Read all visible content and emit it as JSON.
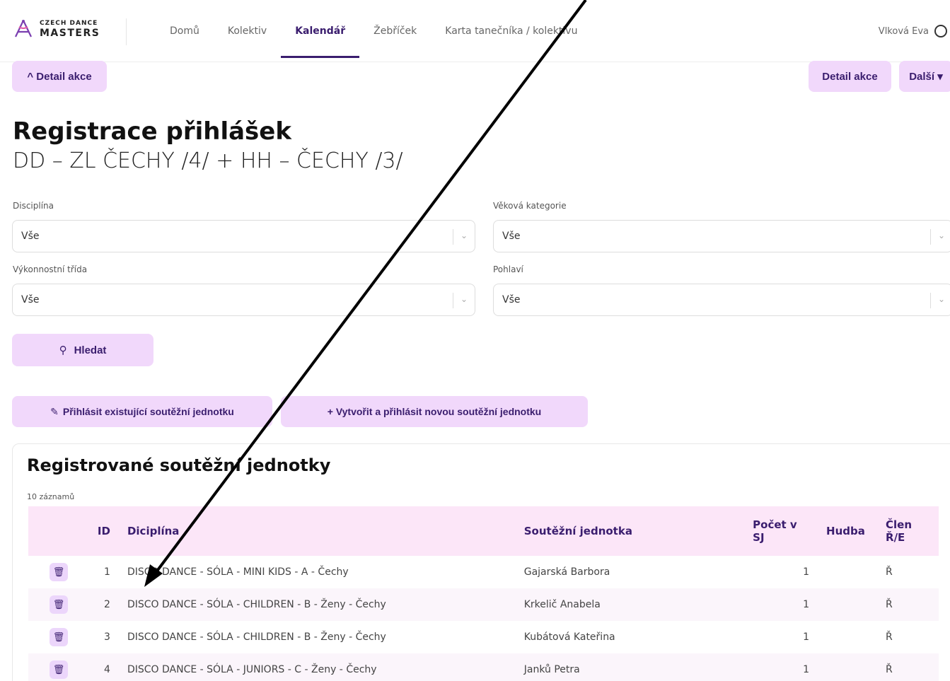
{
  "logo": {
    "line1": "CZECH DANCE",
    "line2": "MASTERS"
  },
  "nav": [
    {
      "label": "Domů",
      "active": false
    },
    {
      "label": "Kolektiv",
      "active": false
    },
    {
      "label": "Kalendář",
      "active": true
    },
    {
      "label": "Žebříček",
      "active": false
    },
    {
      "label": "Karta tanečníka / kolektivu",
      "active": false
    }
  ],
  "user": {
    "name": "Vlková Eva"
  },
  "actions": {
    "detail_left": "^ Detail akce",
    "detail_right": "Detail akce",
    "more": "Další ▾"
  },
  "page": {
    "title": "Registrace přihlášek",
    "subtitle": "DD – ZL ČECHY /4/ + HH – ČECHY /3/"
  },
  "filters": {
    "discipline": {
      "label": "Disciplína",
      "value": "Vše"
    },
    "age_category": {
      "label": "Věková kategorie",
      "value": "Vše"
    },
    "performance_class": {
      "label": "Výkonnostní třída",
      "value": "Vše"
    },
    "gender": {
      "label": "Pohlaví",
      "value": "Vše"
    },
    "search_label": "Hledat"
  },
  "buttons": {
    "register_existing": "Přihlásit existující soutěžní jednotku",
    "create_new": "+ Vytvořit a přihlásit novou soutěžní jednotku"
  },
  "panel": {
    "title": "Registrované soutěžní jednotky",
    "records": "10 záznamů",
    "columns": [
      "",
      "ID",
      "Diciplína",
      "Soutěžní jednotka",
      "Počet v SJ",
      "Hudba",
      "Člen Ř/E"
    ],
    "rows": [
      {
        "id": "1",
        "discipline": "DISCO DANCE - SÓLA - MINI KIDS - A - Čechy",
        "unit": "Gajarská Barbora",
        "count": "1",
        "music": "",
        "member": "Ř"
      },
      {
        "id": "2",
        "discipline": "DISCO DANCE - SÓLA - CHILDREN - B - Ženy - Čechy",
        "unit": "Krkelič Anabela",
        "count": "1",
        "music": "",
        "member": "Ř"
      },
      {
        "id": "3",
        "discipline": "DISCO DANCE - SÓLA - CHILDREN - B - Ženy - Čechy",
        "unit": "Kubátová Kateřina",
        "count": "1",
        "music": "",
        "member": "Ř"
      },
      {
        "id": "4",
        "discipline": "DISCO DANCE - SÓLA - JUNIORS - C - Ženy - Čechy",
        "unit": "Janků Petra",
        "count": "1",
        "music": "",
        "member": "Ř"
      }
    ]
  }
}
